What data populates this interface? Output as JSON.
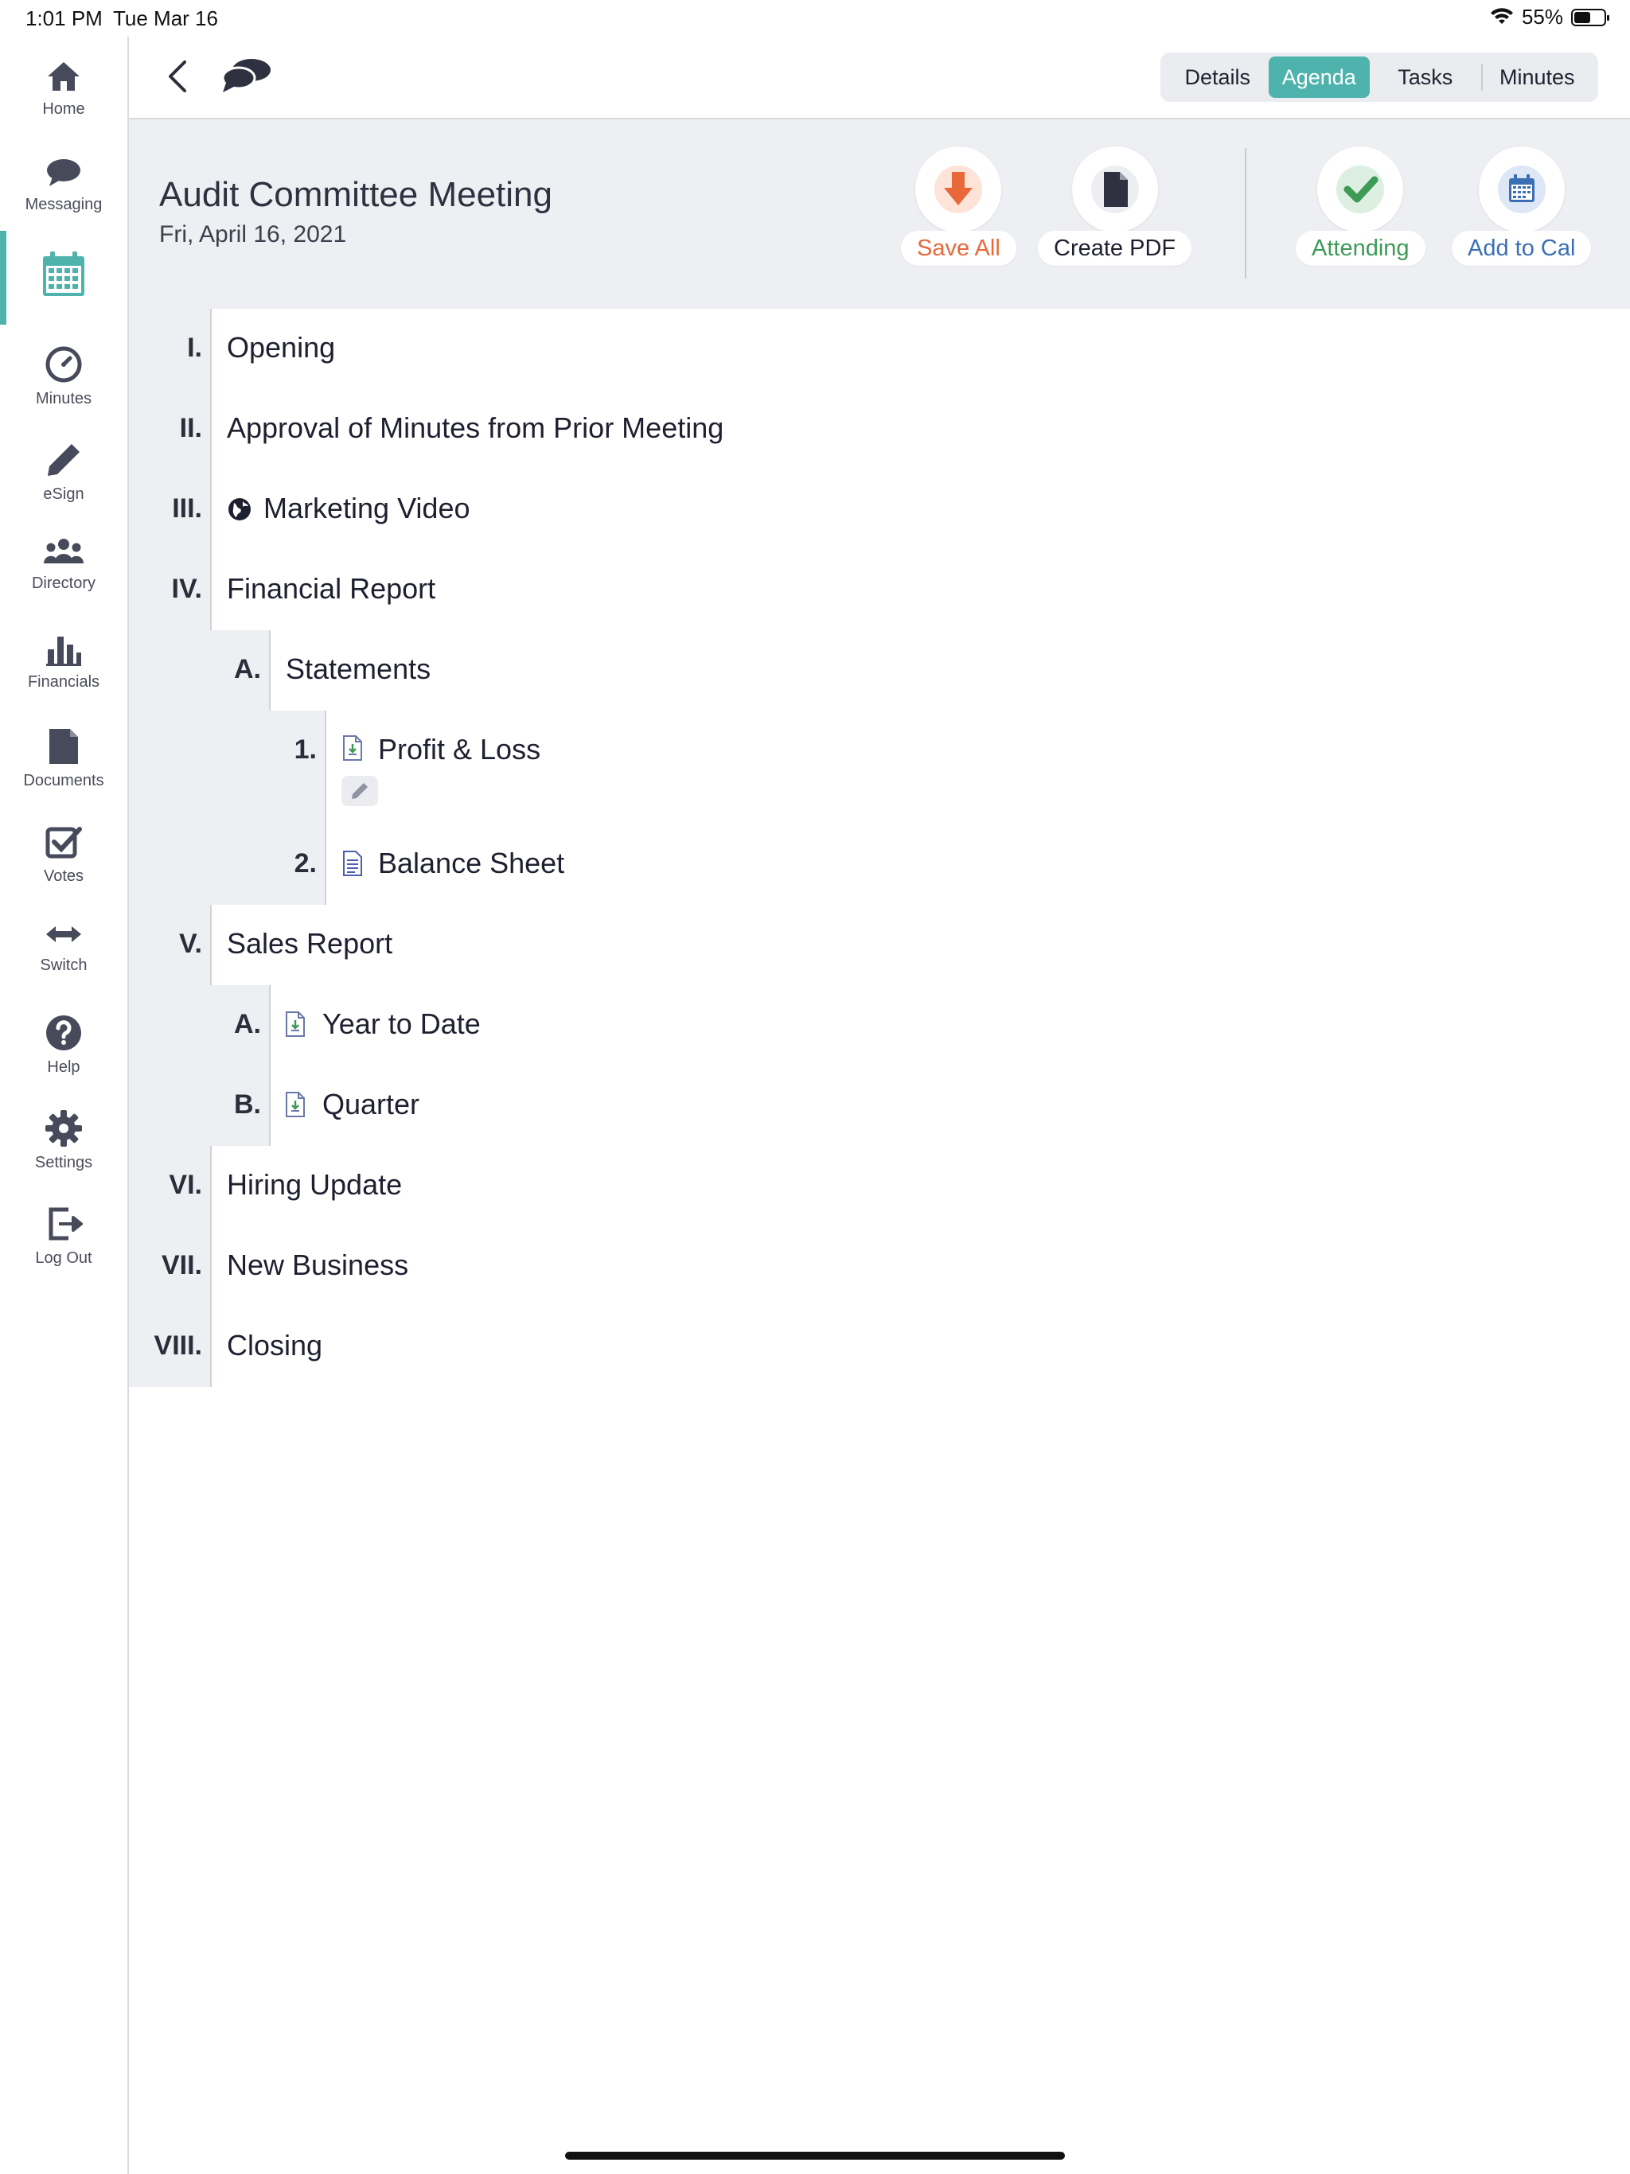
{
  "status": {
    "time": "1:01 PM",
    "date": "Tue Mar 16",
    "battery": "55%",
    "battery_level": 0.55
  },
  "sidebar": {
    "items": [
      {
        "label": "Home",
        "icon": "home-icon"
      },
      {
        "label": "Messaging",
        "icon": "chat-bubble-icon"
      },
      {
        "label": "",
        "icon": "calendar-icon",
        "active": true
      },
      {
        "label": "Minutes",
        "icon": "clock-icon"
      },
      {
        "label": "eSign",
        "icon": "pen-icon"
      },
      {
        "label": "Directory",
        "icon": "people-icon"
      },
      {
        "label": "Financials",
        "icon": "bar-chart-icon"
      },
      {
        "label": "Documents",
        "icon": "document-icon"
      },
      {
        "label": "Votes",
        "icon": "checkbox-icon"
      },
      {
        "label": "Switch",
        "icon": "swap-arrows-icon"
      },
      {
        "label": "Help",
        "icon": "help-icon"
      },
      {
        "label": "Settings",
        "icon": "gear-icon"
      },
      {
        "label": "Log Out",
        "icon": "logout-icon"
      }
    ]
  },
  "header": {
    "tabs": [
      {
        "label": "Details",
        "active": false
      },
      {
        "label": "Agenda",
        "active": true
      },
      {
        "label": "Tasks",
        "active": false
      },
      {
        "label": "Minutes",
        "active": false
      }
    ]
  },
  "meeting": {
    "title": "Audit Committee Meeting",
    "date": "Fri, April 16, 2021",
    "actions": {
      "save_all": "Save All",
      "create_pdf": "Create PDF",
      "attending": "Attending",
      "add_to_cal": "Add to Cal"
    }
  },
  "agenda": [
    {
      "num": "I.",
      "title": "Opening",
      "level": 0
    },
    {
      "num": "II.",
      "title": "Approval of Minutes from Prior Meeting",
      "level": 0
    },
    {
      "num": "III.",
      "title": "Marketing Video",
      "level": 0,
      "icon": "globe-icon"
    },
    {
      "num": "IV.",
      "title": "Financial Report",
      "level": 0
    },
    {
      "num": "A.",
      "title": "Statements",
      "level": 1
    },
    {
      "num": "1.",
      "title": "Profit & Loss",
      "level": 2,
      "icon": "file-download-icon",
      "editable": true
    },
    {
      "num": "2.",
      "title": "Balance Sheet",
      "level": 2,
      "icon": "file-text-icon"
    },
    {
      "num": "V.",
      "title": "Sales Report",
      "level": 0
    },
    {
      "num": "A.",
      "title": "Year to Date",
      "level": 1,
      "icon": "file-download-icon"
    },
    {
      "num": "B.",
      "title": "Quarter",
      "level": 1,
      "icon": "file-download-icon"
    },
    {
      "num": "VI.",
      "title": "Hiring Update",
      "level": 0
    },
    {
      "num": "VII.",
      "title": "New Business",
      "level": 0
    },
    {
      "num": "VIII.",
      "title": "Closing",
      "level": 0
    }
  ],
  "colors": {
    "accent": "#4fb3ad",
    "save": "#e8683a",
    "attending": "#3d9a57",
    "calendar": "#3b6fb5"
  }
}
